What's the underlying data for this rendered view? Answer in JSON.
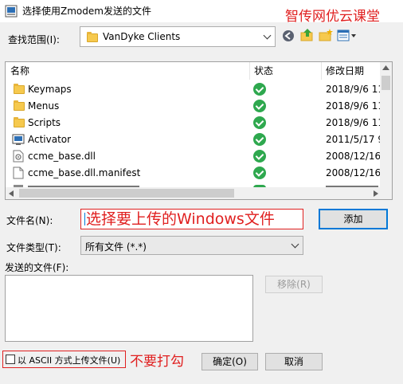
{
  "window": {
    "title": "选择使用Zmodem发送的文件"
  },
  "watermark": "智传网优云课堂",
  "lookin": {
    "label": "查找范围(I):",
    "value": "VanDyke Clients"
  },
  "columns": [
    "名称",
    "状态",
    "修改日期"
  ],
  "files": [
    {
      "name": "Keymaps",
      "date": "2018/9/6 11",
      "icon": "folder-icon"
    },
    {
      "name": "Menus",
      "date": "2018/9/6 11",
      "icon": "folder-icon"
    },
    {
      "name": "Scripts",
      "date": "2018/9/6 11",
      "icon": "folder-icon"
    },
    {
      "name": "Activator",
      "date": "2011/5/17 9",
      "icon": "app-icon"
    },
    {
      "name": "ccme_base.dll",
      "date": "2008/12/16",
      "icon": "dll-icon"
    },
    {
      "name": "ccme_base.dll.manifest",
      "date": "2008/12/16",
      "icon": "file-icon"
    }
  ],
  "filename": {
    "label": "文件名(N):",
    "value": ""
  },
  "filetype": {
    "label": "文件类型(T):",
    "value": "所有文件 (*.*)"
  },
  "send": {
    "label": "发送的文件(F):"
  },
  "buttons": {
    "add": "添加",
    "remove": "移除(R)",
    "ok": "确定(O)",
    "cancel": "取消"
  },
  "ascii_option": {
    "label": "以 ASCII 方式上传文件(U)",
    "checked": false
  },
  "annotations": {
    "filename_hint": "选择要上传的Windows文件",
    "ascii_hint": "不要打勾"
  },
  "colors": {
    "accent": "#0078d7",
    "annotation": "#e02020",
    "status_ok": "#2ea84e"
  }
}
